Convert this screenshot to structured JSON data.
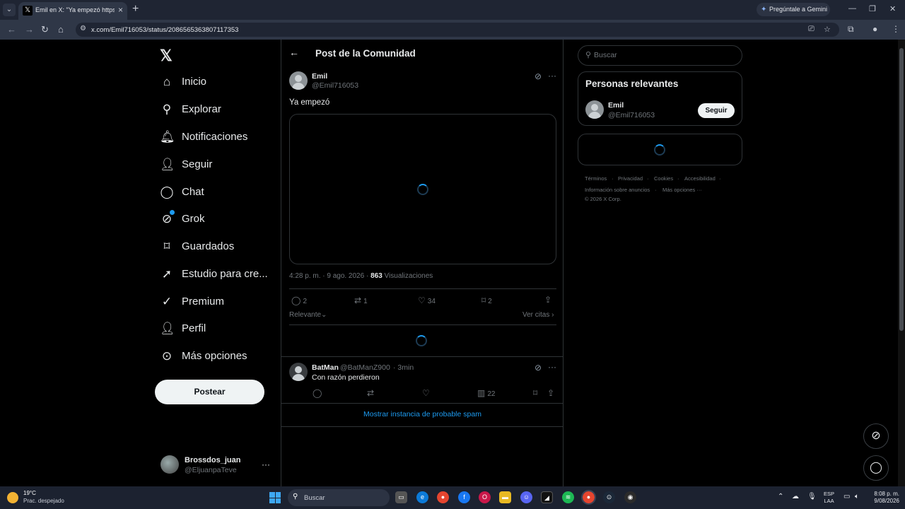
{
  "browser": {
    "tab_title": "Emil en X: \"Ya empezó https://t.co",
    "url": "x.com/Emil716053/status/2086565363807117353",
    "gemini_label": "Pregúntale a Gemini"
  },
  "sidebar": {
    "items": [
      {
        "label": "Inicio",
        "icon": "home-icon"
      },
      {
        "label": "Explorar",
        "icon": "search-icon"
      },
      {
        "label": "Notificaciones",
        "icon": "bell-icon"
      },
      {
        "label": "Seguir",
        "icon": "add-person-icon"
      },
      {
        "label": "Chat",
        "icon": "chat-icon"
      },
      {
        "label": "Grok",
        "icon": "grok-icon"
      },
      {
        "label": "Guardados",
        "icon": "bookmark-icon"
      },
      {
        "label": "Estudio para cre...",
        "icon": "rocket-icon"
      },
      {
        "label": "Premium",
        "icon": "verified-icon"
      },
      {
        "label": "Perfil",
        "icon": "person-icon"
      },
      {
        "label": "Más opciones",
        "icon": "more-circle-icon"
      }
    ],
    "post_button": "Postear",
    "account": {
      "name": "Brossdos_juan",
      "handle": "@EljuanpaTeve"
    }
  },
  "main": {
    "title": "Post de la Comunidad",
    "post": {
      "author": "Emil",
      "handle": "@Emil716053",
      "text": "Ya empezó",
      "time": "4:28 p. m. · 9 ago. 2026 ·",
      "views_count": "863",
      "views_label": "Visualizaciones",
      "replies": "2",
      "reposts": "1",
      "likes": "34",
      "bookmarks": "2"
    },
    "sort_label": "Relevante",
    "quotes_label": "Ver citas",
    "reply": {
      "author": "BatMan",
      "handle": "@BatManZ900",
      "time": "· 3min",
      "text": "Con razón perdieron",
      "views": "22"
    },
    "spam_link": "Mostrar instancia de probable spam"
  },
  "right": {
    "search_placeholder": "Buscar",
    "relevant_title": "Personas relevantes",
    "person": {
      "name": "Emil",
      "handle": "@Emil716053",
      "follow_label": "Seguir"
    },
    "footer": [
      "Términos",
      "Privacidad",
      "Cookies",
      "Accesibilidad",
      "Información sobre anuncios",
      "Más opciones ···",
      "© 2026 X Corp."
    ]
  },
  "taskbar": {
    "temp": "19°C",
    "weather": "Prac. despejado",
    "search": "Buscar",
    "lang_1": "ESP",
    "lang_2": "LAA",
    "time": "8:08 p. m.",
    "date": "9/08/2026"
  },
  "colors": {
    "accent": "#1d9bf0",
    "background": "#000000",
    "border": "#2f3336",
    "muted": "#71767b"
  }
}
